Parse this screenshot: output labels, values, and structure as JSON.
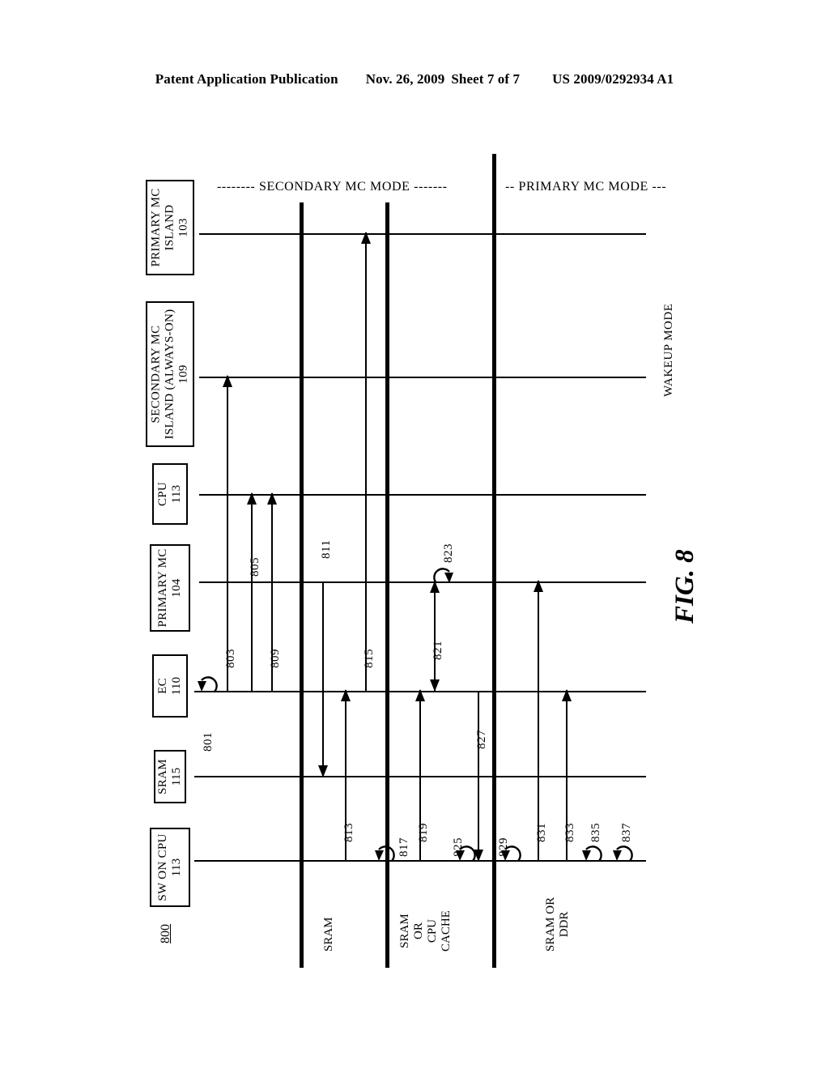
{
  "header": {
    "publication": "Patent Application Publication",
    "date": "Nov. 26, 2009",
    "sheet": "Sheet 7 of 7",
    "number": "US 2009/0292934 A1"
  },
  "figure": {
    "label": "FIG. 8",
    "reference": "800"
  },
  "modes": {
    "secondary": "-------- SECONDARY MC MODE -------",
    "primary": "-- PRIMARY MC  MODE  ---",
    "wakeup": "WAKEUP MODE"
  },
  "participants": [
    {
      "id": "primary-mc-island",
      "name": "PRIMARY MC\nISLAND",
      "ref": "103"
    },
    {
      "id": "secondary-mc-island",
      "name": "SECONDARY MC\nISLAND (ALWAYS-ON)",
      "ref": "109"
    },
    {
      "id": "cpu",
      "name": "CPU",
      "ref": "113"
    },
    {
      "id": "primary-mc",
      "name": "PRIMARY MC",
      "ref": "104"
    },
    {
      "id": "ec",
      "name": "EC",
      "ref": "110"
    },
    {
      "id": "sram",
      "name": "SRAM",
      "ref": "115"
    },
    {
      "id": "sw-on-cpu",
      "name": "SW ON CPU",
      "ref": "113"
    }
  ],
  "messages": [
    {
      "num": "801",
      "kind": "self"
    },
    {
      "num": "803",
      "kind": "arrow"
    },
    {
      "num": "805",
      "kind": "arrow"
    },
    {
      "num": "809",
      "kind": "arrow"
    },
    {
      "num": "811",
      "kind": "arrow"
    },
    {
      "num": "813",
      "kind": "arrow"
    },
    {
      "num": "815",
      "kind": "arrow"
    },
    {
      "num": "817",
      "kind": "self"
    },
    {
      "num": "819",
      "kind": "arrow"
    },
    {
      "num": "821",
      "kind": "arrow"
    },
    {
      "num": "823",
      "kind": "self"
    },
    {
      "num": "825",
      "kind": "self"
    },
    {
      "num": "827",
      "kind": "arrow"
    },
    {
      "num": "829",
      "kind": "self"
    },
    {
      "num": "831",
      "kind": "arrow"
    },
    {
      "num": "833",
      "kind": "arrow"
    },
    {
      "num": "835",
      "kind": "self"
    },
    {
      "num": "837",
      "kind": "self"
    }
  ],
  "memory_notes": [
    {
      "id": "note-sram",
      "text": "SRAM"
    },
    {
      "id": "note-sram-or-cpu-cache",
      "text": "SRAM\nOR\nCPU\nCACHE"
    },
    {
      "id": "note-sram-or-ddr",
      "text": "SRAM OR\nDDR"
    }
  ],
  "colors": {
    "ink": "#000000",
    "paper": "#ffffff"
  }
}
